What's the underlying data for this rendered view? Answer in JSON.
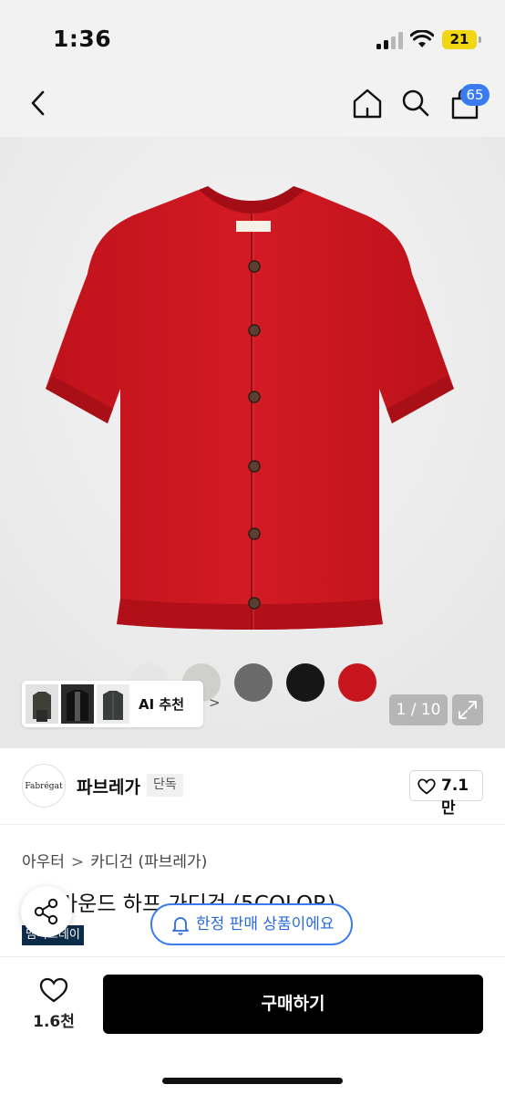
{
  "status": {
    "time": "1:36",
    "battery": "21"
  },
  "nav": {
    "cart_count": "65"
  },
  "product": {
    "color_swatches": [
      "#e6e6e6",
      "#cfcfcb",
      "#6a6a6a",
      "#161616",
      "#c8141c"
    ],
    "ai_recommend_label": "AI 추천",
    "image_counter": "1 / 10"
  },
  "brand": {
    "logo_text": "Fabrégat",
    "name": "파브레가",
    "tag": "단독",
    "like_count": "7.1만"
  },
  "breadcrumb": {
    "category": "아우터",
    "subcategory": "카디건 (파브레가)"
  },
  "title": "라운드 하프 가디건 (5COLOR)",
  "event_badge": "멤버스데이",
  "limited_notice": "한정 판매 상품이에요",
  "bottom": {
    "wish_count": "1.6천",
    "buy_label": "구매하기"
  }
}
